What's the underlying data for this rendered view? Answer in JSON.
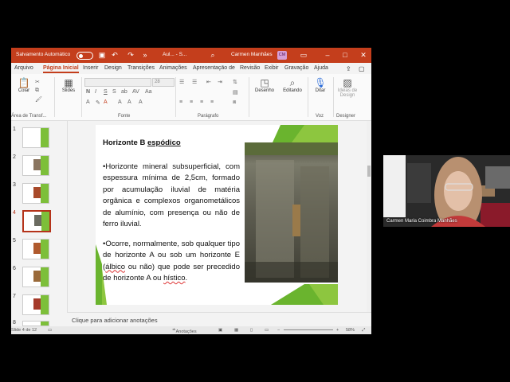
{
  "titlebar": {
    "autosave_label": "Salvamento Automático",
    "doc_name": "Aul... - S...",
    "user_name": "Carmen Manhães",
    "user_initials": "CM"
  },
  "menu": {
    "tabs": [
      "Arquivo",
      "Página Inicial",
      "Inserir",
      "Design",
      "Transições",
      "Animações",
      "Apresentação de",
      "Revisão",
      "Exibir",
      "Gravação",
      "Ajuda"
    ]
  },
  "ribbon": {
    "paste_label": "Colar",
    "slides_label": "Slides",
    "font_size": "28",
    "draw_label": "Desenho",
    "editing_label": "Editando",
    "dictate_label": "Ditar",
    "design_ideas_label": "Ideias de Design",
    "groups": {
      "clipboard": "Área de Transf...",
      "font": "Fonte",
      "paragraph": "Parágrafo",
      "voice": "Voz",
      "designer": "Designer"
    }
  },
  "slides_panel": {
    "numbers": [
      "1",
      "2",
      "3",
      "4",
      "5",
      "6",
      "7",
      "8"
    ],
    "selected": 4
  },
  "slide": {
    "title_prefix": "Horizonte B ",
    "title_underlined": "espódico",
    "p1": "•Horizonte mineral subsuperficial, com espessura mínima de 2,5cm, formado por acumulação iluvial de matéria orgânica e complexos organometálicos de alumínio, com presença ou não de ferro iluvial.",
    "p2_a": "•Ocorre, normalmente, sob qualquer tipo de horizonte A ou sob um horizonte E (",
    "p2_u1": "álbico",
    "p2_b": " ou não) que pode ser precedido de horizonte A ou ",
    "p2_u2": "hístico",
    "p2_c": "."
  },
  "notes": {
    "placeholder": "Clique para adicionar anotações"
  },
  "status": {
    "slide_count": "Slide 4 de 12",
    "notes_button": "Anotações",
    "zoom": "58%"
  },
  "video": {
    "participant_name": "Carmen Maria Coimbra Manhães"
  },
  "colors": {
    "accent": "#c43e1c",
    "slide_green": "#6ab42e",
    "selection": "#b5331a"
  }
}
